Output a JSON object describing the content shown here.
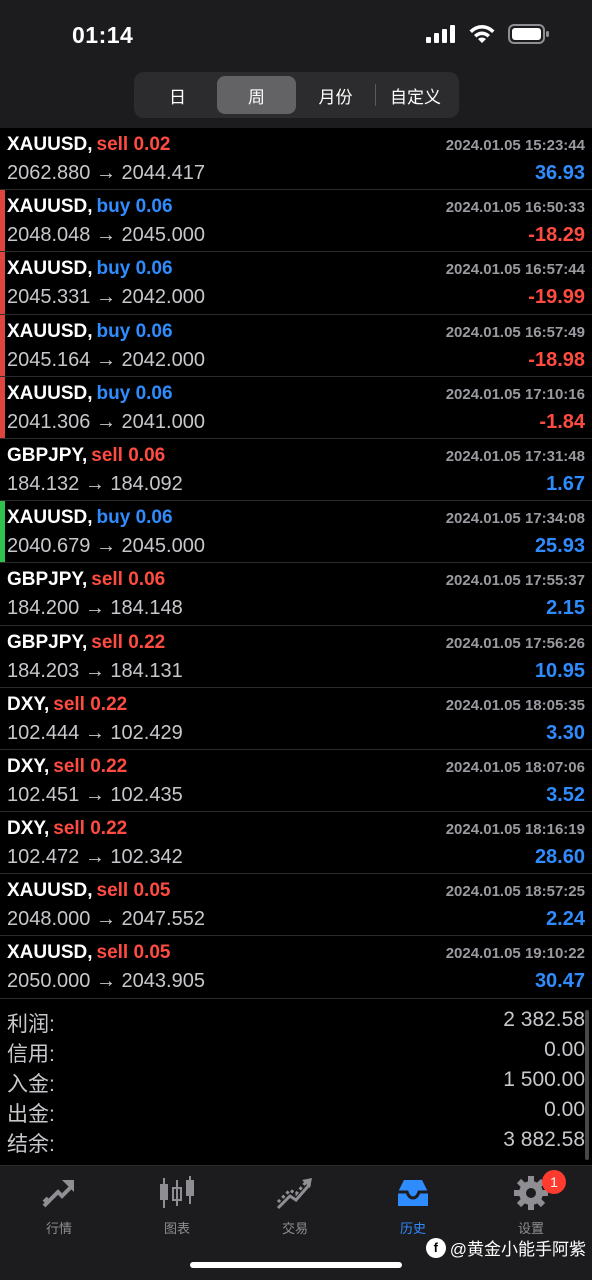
{
  "status_bar": {
    "time": "01:14"
  },
  "segments": [
    {
      "label": "日",
      "active": false
    },
    {
      "label": "周",
      "active": true
    },
    {
      "label": "月份",
      "active": false
    },
    {
      "label": "自定义",
      "active": false
    }
  ],
  "trades": [
    {
      "symbol": "XAUUSD,",
      "action": "sell 0.02",
      "side": "sell",
      "datetime": "2024.01.05 15:23:44",
      "prices": "2062.880 → 2044.417",
      "profit": "36.93",
      "profit_sign": "pos",
      "marker": ""
    },
    {
      "symbol": "XAUUSD,",
      "action": "buy 0.06",
      "side": "buy",
      "datetime": "2024.01.05 16:50:33",
      "prices": "2048.048 → 2045.000",
      "profit": "-18.29",
      "profit_sign": "neg",
      "marker": "red"
    },
    {
      "symbol": "XAUUSD,",
      "action": "buy 0.06",
      "side": "buy",
      "datetime": "2024.01.05 16:57:44",
      "prices": "2045.331 → 2042.000",
      "profit": "-19.99",
      "profit_sign": "neg",
      "marker": "red"
    },
    {
      "symbol": "XAUUSD,",
      "action": "buy 0.06",
      "side": "buy",
      "datetime": "2024.01.05 16:57:49",
      "prices": "2045.164 → 2042.000",
      "profit": "-18.98",
      "profit_sign": "neg",
      "marker": "red"
    },
    {
      "symbol": "XAUUSD,",
      "action": "buy 0.06",
      "side": "buy",
      "datetime": "2024.01.05 17:10:16",
      "prices": "2041.306 → 2041.000",
      "profit": "-1.84",
      "profit_sign": "neg",
      "marker": "red"
    },
    {
      "symbol": "GBPJPY,",
      "action": "sell 0.06",
      "side": "sell",
      "datetime": "2024.01.05 17:31:48",
      "prices": "184.132 → 184.092",
      "profit": "1.67",
      "profit_sign": "pos",
      "marker": ""
    },
    {
      "symbol": "XAUUSD,",
      "action": "buy 0.06",
      "side": "buy",
      "datetime": "2024.01.05 17:34:08",
      "prices": "2040.679 → 2045.000",
      "profit": "25.93",
      "profit_sign": "pos",
      "marker": "green"
    },
    {
      "symbol": "GBPJPY,",
      "action": "sell 0.06",
      "side": "sell",
      "datetime": "2024.01.05 17:55:37",
      "prices": "184.200 → 184.148",
      "profit": "2.15",
      "profit_sign": "pos",
      "marker": ""
    },
    {
      "symbol": "GBPJPY,",
      "action": "sell 0.22",
      "side": "sell",
      "datetime": "2024.01.05 17:56:26",
      "prices": "184.203 → 184.131",
      "profit": "10.95",
      "profit_sign": "pos",
      "marker": ""
    },
    {
      "symbol": "DXY,",
      "action": "sell 0.22",
      "side": "sell",
      "datetime": "2024.01.05 18:05:35",
      "prices": "102.444 → 102.429",
      "profit": "3.30",
      "profit_sign": "pos",
      "marker": ""
    },
    {
      "symbol": "DXY,",
      "action": "sell 0.22",
      "side": "sell",
      "datetime": "2024.01.05 18:07:06",
      "prices": "102.451 → 102.435",
      "profit": "3.52",
      "profit_sign": "pos",
      "marker": ""
    },
    {
      "symbol": "DXY,",
      "action": "sell 0.22",
      "side": "sell",
      "datetime": "2024.01.05 18:16:19",
      "prices": "102.472 → 102.342",
      "profit": "28.60",
      "profit_sign": "pos",
      "marker": ""
    },
    {
      "symbol": "XAUUSD,",
      "action": "sell 0.05",
      "side": "sell",
      "datetime": "2024.01.05 18:57:25",
      "prices": "2048.000 → 2047.552",
      "profit": "2.24",
      "profit_sign": "pos",
      "marker": ""
    },
    {
      "symbol": "XAUUSD,",
      "action": "sell 0.05",
      "side": "sell",
      "datetime": "2024.01.05 19:10:22",
      "prices": "2050.000 → 2043.905",
      "profit": "30.47",
      "profit_sign": "pos",
      "marker": ""
    }
  ],
  "summary": [
    {
      "label": "利润:",
      "value": "2 382.58"
    },
    {
      "label": "信用:",
      "value": "0.00"
    },
    {
      "label": "入金:",
      "value": "1 500.00"
    },
    {
      "label": "出金:",
      "value": "0.00"
    },
    {
      "label": "结余:",
      "value": "3 882.58"
    }
  ],
  "tabs": [
    {
      "label": "行情",
      "icon": "quotes-icon",
      "active": false
    },
    {
      "label": "图表",
      "icon": "chart-icon",
      "active": false
    },
    {
      "label": "交易",
      "icon": "trade-icon",
      "active": false
    },
    {
      "label": "历史",
      "icon": "history-icon",
      "active": true
    },
    {
      "label": "设置",
      "icon": "settings-icon",
      "active": false,
      "badge": "1"
    }
  ],
  "watermark": {
    "text": "@黄金小能手阿紫"
  },
  "colors": {
    "sell": "#ff4b40",
    "buy": "#2f8cff",
    "profit_positive": "#2f8cff",
    "profit_negative": "#ff4b40",
    "background": "#000000"
  }
}
